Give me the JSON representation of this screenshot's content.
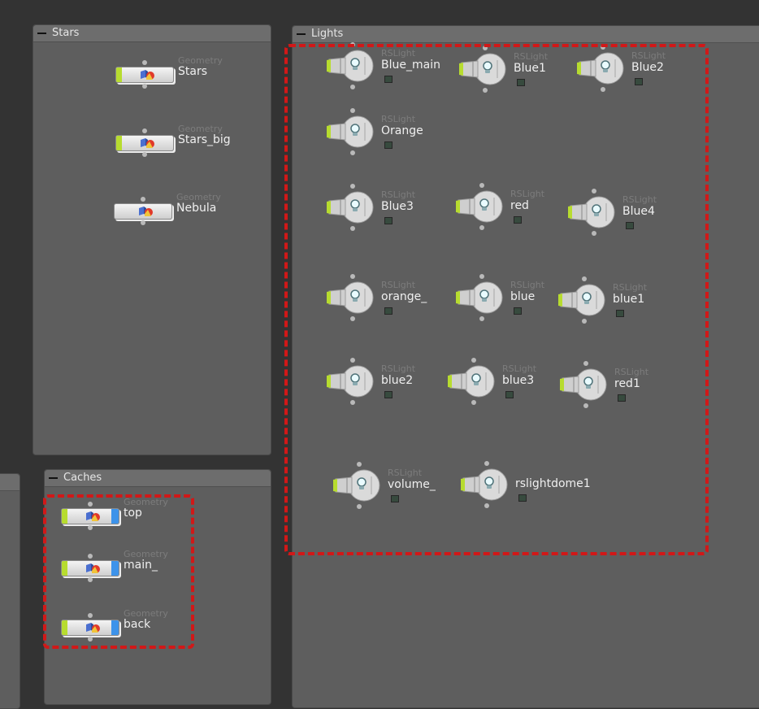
{
  "networks": {
    "stars": {
      "title": "Stars",
      "nodes": [
        {
          "type": "Geometry",
          "name": "Stars",
          "flag": "left"
        },
        {
          "type": "Geometry",
          "name": "Stars_big",
          "flag": "left"
        },
        {
          "type": "Geometry",
          "name": "Nebula",
          "flag": "none"
        }
      ]
    },
    "caches": {
      "title": "Caches",
      "nodes": [
        {
          "type": "Geometry",
          "name": "top",
          "flag": "both"
        },
        {
          "type": "Geometry",
          "name": "main_",
          "flag": "both"
        },
        {
          "type": "Geometry",
          "name": "back",
          "flag": "both"
        }
      ]
    },
    "lights": {
      "title": "Lights",
      "nodes": [
        {
          "type": "RSLight",
          "name": "Blue_main"
        },
        {
          "type": "RSLight",
          "name": "Blue1"
        },
        {
          "type": "RSLight",
          "name": "Blue2"
        },
        {
          "type": "RSLight",
          "name": "Orange"
        },
        {
          "type": "RSLight",
          "name": "Blue3"
        },
        {
          "type": "RSLight",
          "name": "red"
        },
        {
          "type": "RSLight",
          "name": "Blue4"
        },
        {
          "type": "RSLight",
          "name": "orange_"
        },
        {
          "type": "RSLight",
          "name": "blue"
        },
        {
          "type": "RSLight",
          "name": "blue1"
        },
        {
          "type": "RSLight",
          "name": "blue2"
        },
        {
          "type": "RSLight",
          "name": "blue3"
        },
        {
          "type": "RSLight",
          "name": "red1"
        },
        {
          "type": "RSLight",
          "name": "volume_"
        },
        {
          "type": "",
          "name": "rslightdome1"
        }
      ]
    }
  },
  "colors": {
    "background": "#333333",
    "network_box": "#5e5e5e",
    "display_flag": "#b7dc2f",
    "render_flag": "#3d93ea",
    "selection": "#d11818"
  }
}
